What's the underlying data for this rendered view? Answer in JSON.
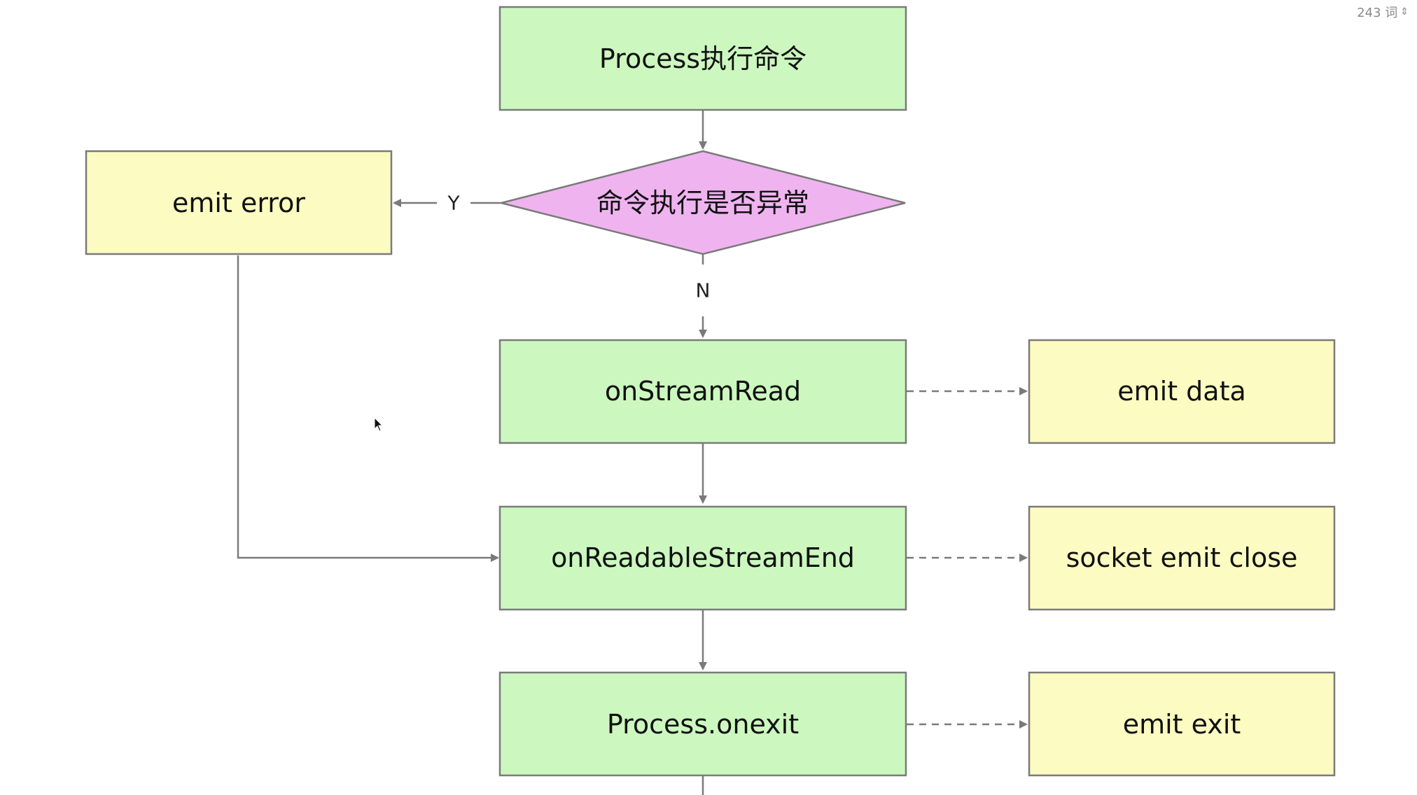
{
  "word_count": {
    "label": "243 词",
    "icon": "updown-chevron-icon"
  },
  "colors": {
    "process_fill": "#ccf8c0",
    "output_fill": "#fbfbc2",
    "decision_fill": "#efb4f0",
    "stroke": "#7a7a7a"
  },
  "nodes": {
    "start": "Process执行命令",
    "decision": "命令执行是否异常",
    "emit_error": "emit error",
    "on_stream_read": "onStreamRead",
    "on_readable_stream_end": "onReadableStreamEnd",
    "process_onexit": "Process.onexit",
    "emit_data": "emit data",
    "socket_emit_close": "socket emit close",
    "emit_exit": "emit exit"
  },
  "edge_labels": {
    "yes": "Y",
    "no": "N"
  }
}
